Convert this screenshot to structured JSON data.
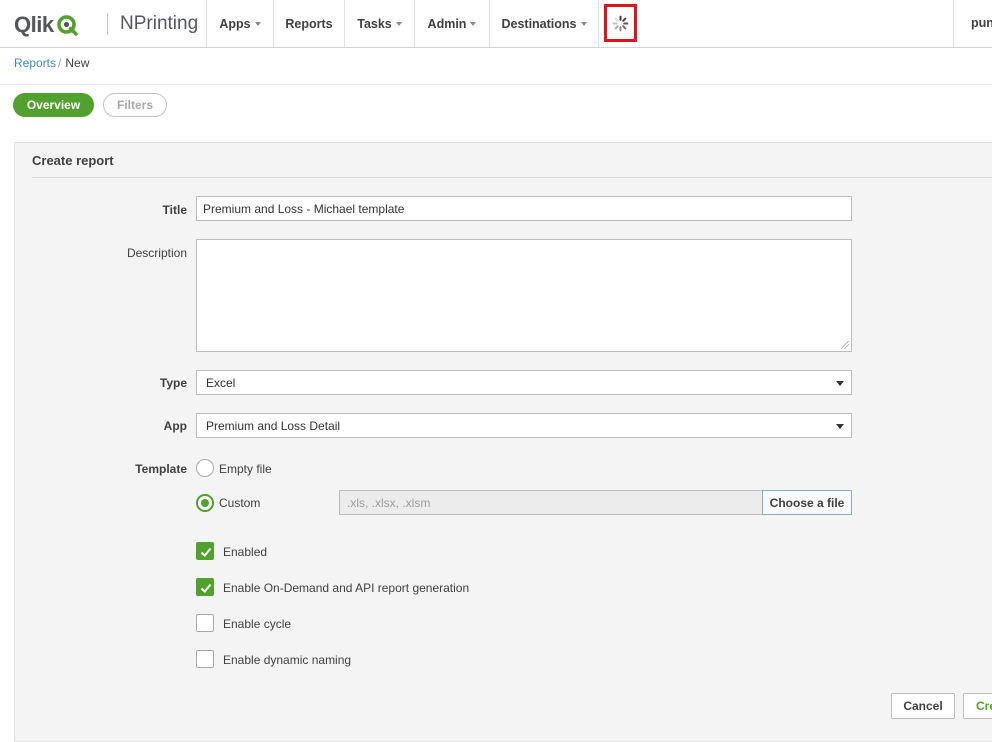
{
  "brand": {
    "logo_text": "Qlik",
    "product_name": "NPrinting",
    "accent_color": "#52a12e"
  },
  "nav": {
    "items": [
      {
        "label": "Apps",
        "has_dropdown": true
      },
      {
        "label": "Reports",
        "has_dropdown": false
      },
      {
        "label": "Tasks",
        "has_dropdown": true
      },
      {
        "label": "Admin",
        "has_dropdown": true
      },
      {
        "label": "Destinations",
        "has_dropdown": true
      }
    ],
    "loading_indicator": "spinner-icon",
    "user_label": "pun"
  },
  "breadcrumb": {
    "parent": "Reports",
    "separator": "/",
    "current": "New"
  },
  "tabs": {
    "overview": "Overview",
    "filters": "Filters"
  },
  "form": {
    "heading": "Create report",
    "title_label": "Title",
    "title_value": "Premium and Loss  - Michael template",
    "description_label": "Description",
    "description_value": "",
    "type_label": "Type",
    "type_value": "Excel",
    "app_label": "App",
    "app_value": "Premium and Loss Detail",
    "template_label": "Template",
    "template_options": {
      "empty": "Empty file",
      "custom": "Custom"
    },
    "template_selected": "Custom",
    "file_placeholder": ".xls, .xlsx, .xlsm",
    "choose_file_label": "Choose a file",
    "checkboxes": [
      {
        "label": "Enabled",
        "checked": true
      },
      {
        "label": "Enable On-Demand and API report generation",
        "checked": true
      },
      {
        "label": "Enable cycle",
        "checked": false
      },
      {
        "label": "Enable dynamic naming",
        "checked": false
      }
    ]
  },
  "actions": {
    "cancel": "Cancel",
    "create": "Cre"
  }
}
